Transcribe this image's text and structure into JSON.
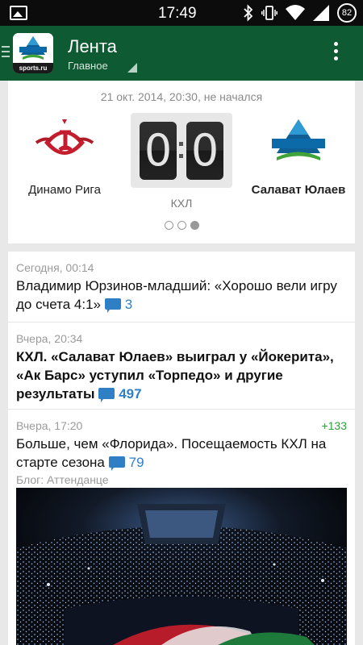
{
  "status_bar": {
    "time": "17:49",
    "battery": "82",
    "icons": [
      "gallery-icon",
      "bluetooth-icon",
      "vibrate-icon",
      "wifi-icon",
      "signal-icon",
      "battery-icon"
    ]
  },
  "app_bar": {
    "logo_text": "sports.ru",
    "title": "Лента",
    "subtitle": "Главное",
    "colors": {
      "bar": "#0e5a32"
    }
  },
  "match": {
    "datetime_status": "21 окт. 2014, 20:30, не начался",
    "home_team": "Динамо Рига",
    "away_team": "Салават Юлаев",
    "home_score": "0",
    "away_score": "0",
    "league": "КХЛ",
    "pager": {
      "pages": 3,
      "active": 3
    }
  },
  "feed": {
    "items": [
      {
        "time": "Сегодня, 00:14",
        "title": "Владимир Юрзинов-младший: «Хорошо вели игру до счета 4:1»",
        "comments": "3"
      },
      {
        "time": "Вчера, 20:34",
        "title": "КХЛ. «Салават Юлаев» выиграл у «Йокерита», «Ак Барс» уступил «Торпедо» и другие результаты",
        "comments": "497"
      },
      {
        "time": "Вчера, 17:20",
        "rating": "+133",
        "title": "Больше, чем «Флорида». Посещаемость КХЛ на старте сезона",
        "comments": "79",
        "source": "Блог: Аттенданце"
      }
    ]
  },
  "colors": {
    "link": "#2f7fc5",
    "positive": "#2ea041"
  }
}
